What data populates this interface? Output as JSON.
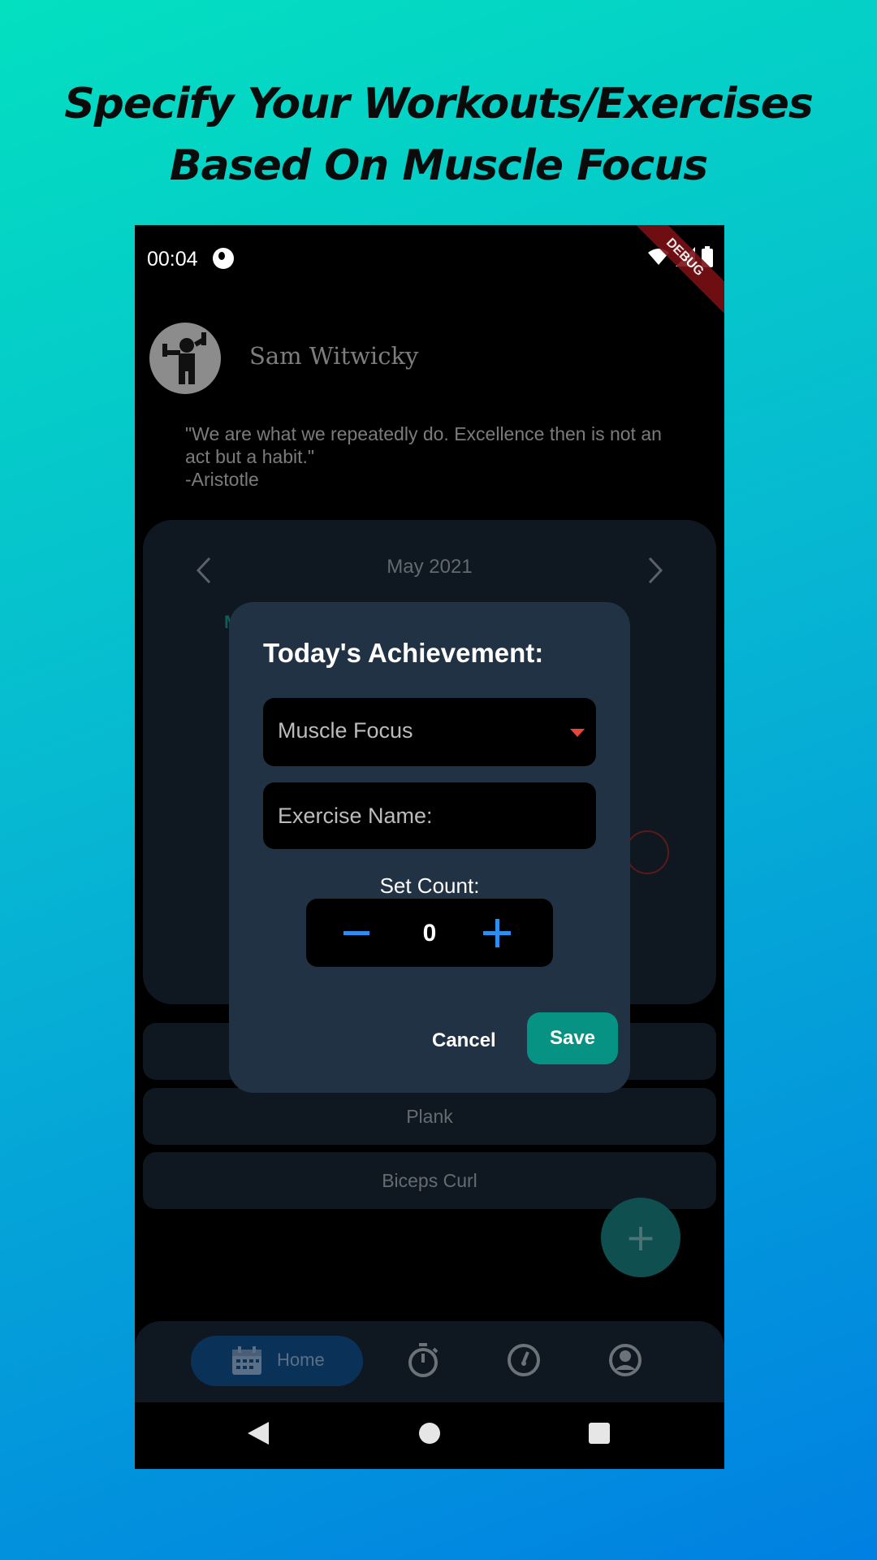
{
  "headline": {
    "line1": "Specify Your Workouts/Exercises",
    "line2": "Based On Muscle Focus"
  },
  "status_bar": {
    "time": "00:04",
    "debug_label": "DEBUG"
  },
  "profile": {
    "name": "Sam Witwicky"
  },
  "quote": {
    "text": "\"We are what we repeatedly do. Excellence then is not an act but a habit.\"\n -Aristotle"
  },
  "calendar": {
    "month": "May 2021",
    "partial_weekday": "M"
  },
  "exercise_list": {
    "items": [
      "Plank",
      "Biceps Curl"
    ]
  },
  "bottom_nav": {
    "home_label": "Home"
  },
  "dialog": {
    "title": "Today's Achievement:",
    "muscle_focus_placeholder": "Muscle Focus",
    "exercise_name_placeholder": "Exercise Name:",
    "set_count_label": "Set Count:",
    "set_count_value": "0",
    "cancel_label": "Cancel",
    "save_label": "Save"
  },
  "colors": {
    "accent_teal": "#079383",
    "stepper_blue": "#2e8ef0",
    "dropdown_caret": "#e9463a",
    "dialog_bg": "#203244"
  },
  "icons": {
    "status": [
      "app-icon",
      "wifi-icon",
      "signal-icon",
      "battery-icon"
    ],
    "nav": [
      "calendar-icon",
      "stopwatch-icon",
      "speedometer-icon",
      "account-icon"
    ]
  }
}
